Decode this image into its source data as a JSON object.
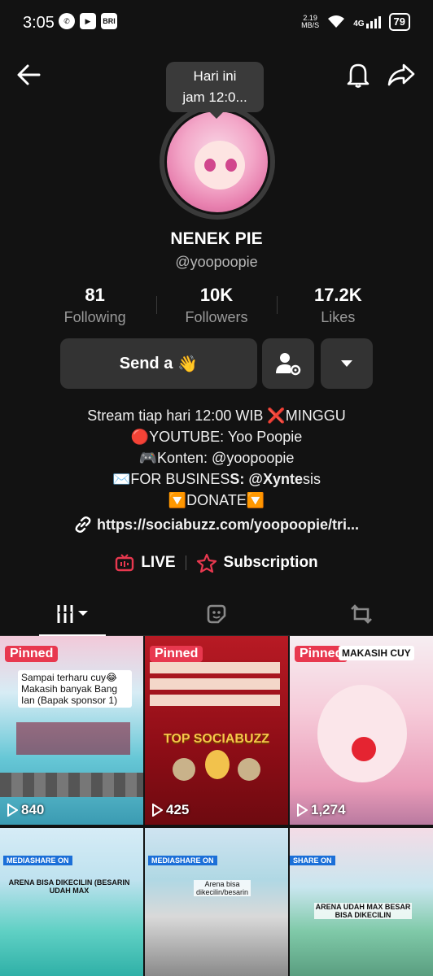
{
  "status_bar": {
    "time": "3:05",
    "net_speed_top": "2.19",
    "net_speed_bottom": "MB/S",
    "network": "4G",
    "battery": "79"
  },
  "header": {
    "tooltip_line1": "Hari ini",
    "tooltip_line2": "jam 12:0..."
  },
  "profile": {
    "name": "NENEK PIE",
    "handle": "@yoopoopie",
    "stats": [
      {
        "value": "81",
        "label": "Following"
      },
      {
        "value": "10K",
        "label": "Followers"
      },
      {
        "value": "17.2K",
        "label": "Likes"
      }
    ],
    "send_label": "Send a",
    "send_emoji": "👋",
    "bio": {
      "line1": "Stream tiap hari 12:00 WIB ❌MINGGU",
      "line2": "🔴YOUTUBE: Yoo Poopie",
      "line3": "🎮Konten: @yoopoopie",
      "line4_a": "✉️FOR BUSINES",
      "line4_b": "S: @Xynte",
      "line4_c": "sis",
      "line5": "🔽DONATE🔽"
    },
    "link": "https://sociabuzz.com/yoopoopie/tri...",
    "live_label": "LIVE",
    "subscription_label": "Subscription"
  },
  "grid": {
    "items": [
      {
        "pinned": "Pinned",
        "views": "840",
        "caption": "Sampai terharu cuy😂 Makasih banyak Bang Ian (Bapak sponsor 1)"
      },
      {
        "pinned": "Pinned",
        "views": "425",
        "banner": "TOP SOCIABUZZ"
      },
      {
        "pinned": "Pinned",
        "views": "1,274",
        "caption": "MAKASIH CUY"
      },
      {
        "tag": "MEDIASHARE ON",
        "caption": "ARENA BISA DIKECILIN (BESARIN UDAH MAX"
      },
      {
        "tag": "MEDIASHARE ON",
        "caption": "Arena bisa dikecilin/besarin"
      },
      {
        "tag": "SHARE ON",
        "caption": "ARENA UDAH MAX BESAR BISA DIKECILIN"
      }
    ]
  },
  "colors": {
    "background": "#121212",
    "pinned": "#e8384f",
    "button": "#333333",
    "live": "#e8384f"
  }
}
